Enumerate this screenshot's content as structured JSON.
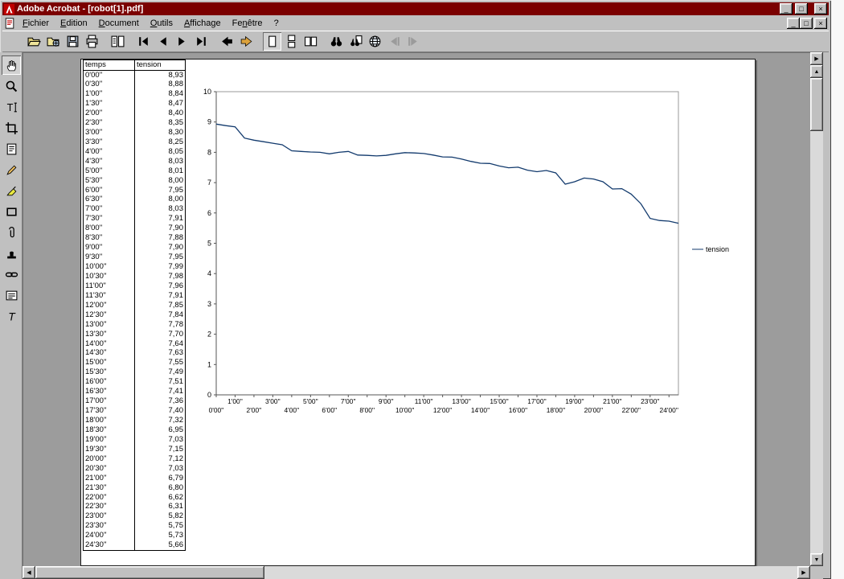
{
  "colors": {
    "titlebar": "#7b0000",
    "chrome": "#c0c0c0",
    "doc_bg": "#9c9c9c",
    "page": "#ffffff",
    "series": "#123a6d"
  },
  "titlebar": {
    "title": "Adobe Acrobat - [robot[1].pdf]",
    "app_icon": "acrobat-logo-icon",
    "minimize": "_",
    "maximize": "□",
    "close": "×"
  },
  "menubar": {
    "doc_icon": "pdf-document-icon",
    "items": [
      {
        "name": "fichier",
        "pre": "",
        "u": "F",
        "post": "ichier"
      },
      {
        "name": "edition",
        "pre": "",
        "u": "E",
        "post": "dition"
      },
      {
        "name": "document",
        "pre": "",
        "u": "D",
        "post": "ocument"
      },
      {
        "name": "outils",
        "pre": "",
        "u": "O",
        "post": "utils"
      },
      {
        "name": "affichage",
        "pre": "",
        "u": "A",
        "post": "ffichage"
      },
      {
        "name": "fenetre",
        "pre": "Fe",
        "u": "n",
        "post": "être"
      },
      {
        "name": "aide",
        "pre": "?",
        "u": "",
        "post": ""
      }
    ],
    "minimize": "_",
    "restore": "□",
    "close": "×"
  },
  "toolbar": {
    "buttons": [
      {
        "name": "open",
        "icon": "folder-open"
      },
      {
        "name": "open-web",
        "icon": "folder-web"
      },
      {
        "name": "save",
        "icon": "floppy"
      },
      {
        "name": "print",
        "icon": "printer"
      },
      {
        "sep": true
      },
      {
        "name": "navpane-toggle",
        "icon": "navpane"
      },
      {
        "sep": true
      },
      {
        "name": "first-page",
        "icon": "first"
      },
      {
        "name": "prev-page",
        "icon": "prev"
      },
      {
        "name": "next-page",
        "icon": "next"
      },
      {
        "name": "last-page",
        "icon": "last"
      },
      {
        "sep": true
      },
      {
        "name": "prev-view",
        "icon": "arrow-left"
      },
      {
        "name": "next-view",
        "icon": "arrow-right"
      },
      {
        "sep": true
      },
      {
        "name": "layout-single",
        "icon": "page-single",
        "pressed": true
      },
      {
        "name": "layout-continuous",
        "icon": "page-continuous"
      },
      {
        "name": "layout-facing",
        "icon": "page-facing"
      },
      {
        "sep": true
      },
      {
        "name": "find",
        "icon": "binoculars"
      },
      {
        "name": "search",
        "icon": "search-doc"
      },
      {
        "name": "search-web",
        "icon": "globe"
      },
      {
        "name": "prev-highlight",
        "icon": "hl-prev",
        "disabled": true
      },
      {
        "name": "next-highlight",
        "icon": "hl-next",
        "disabled": true
      }
    ]
  },
  "toolpalette": {
    "tools": [
      {
        "name": "hand",
        "icon": "hand",
        "pressed": true
      },
      {
        "name": "zoom",
        "icon": "magnifier"
      },
      {
        "name": "text-select",
        "icon": "text-select"
      },
      {
        "name": "crop",
        "icon": "crop"
      },
      {
        "name": "note",
        "icon": "note"
      },
      {
        "name": "pencil",
        "icon": "pencil"
      },
      {
        "name": "highlight",
        "icon": "highlighter"
      },
      {
        "name": "square",
        "icon": "rect"
      },
      {
        "name": "attach",
        "icon": "paperclip"
      },
      {
        "name": "stamp",
        "icon": "stamp"
      },
      {
        "name": "link",
        "icon": "link"
      },
      {
        "name": "form",
        "icon": "form"
      },
      {
        "name": "touchup-text",
        "icon": "touchup"
      }
    ]
  },
  "document": {
    "table": {
      "headers": [
        "temps",
        "tension"
      ],
      "decimal_separator": ","
    }
  },
  "chart_data": {
    "type": "line",
    "title": "",
    "xlabel": "",
    "ylabel": "",
    "ylim": [
      0,
      10
    ],
    "ytick_step": 1,
    "grid": false,
    "legend_position": "right",
    "x": [
      "0'00''",
      "0'30''",
      "1'00''",
      "1'30''",
      "2'00''",
      "2'30''",
      "3'00''",
      "3'30''",
      "4'00''",
      "4'30''",
      "5'00''",
      "5'30''",
      "6'00''",
      "6'30''",
      "7'00''",
      "7'30''",
      "8'00''",
      "8'30''",
      "9'00''",
      "9'30''",
      "10'00''",
      "10'30''",
      "11'00''",
      "11'30''",
      "12'00''",
      "12'30''",
      "13'00''",
      "13'30''",
      "14'00''",
      "14'30''",
      "15'00''",
      "15'30''",
      "16'00''",
      "16'30''",
      "17'00''",
      "17'30''",
      "18'00''",
      "18'30''",
      "19'00''",
      "19'30''",
      "20'00''",
      "20'30''",
      "21'00''",
      "21'30''",
      "22'00''",
      "22'30''",
      "23'00''",
      "23'30''",
      "24'00''",
      "24'30''"
    ],
    "series": [
      {
        "name": "tension",
        "values": [
          8.93,
          8.88,
          8.84,
          8.47,
          8.4,
          8.35,
          8.3,
          8.25,
          8.05,
          8.03,
          8.01,
          8.0,
          7.95,
          8.0,
          8.03,
          7.91,
          7.9,
          7.88,
          7.9,
          7.95,
          7.99,
          7.98,
          7.96,
          7.91,
          7.85,
          7.84,
          7.78,
          7.7,
          7.64,
          7.63,
          7.55,
          7.49,
          7.51,
          7.41,
          7.36,
          7.4,
          7.32,
          6.95,
          7.03,
          7.15,
          7.12,
          7.03,
          6.79,
          6.8,
          6.62,
          6.31,
          5.82,
          5.75,
          5.73,
          5.66
        ]
      }
    ]
  },
  "scrollbars": {
    "up": "▲",
    "down": "▼",
    "left": "◀",
    "right": "▶"
  },
  "pane_arrow": "▶"
}
